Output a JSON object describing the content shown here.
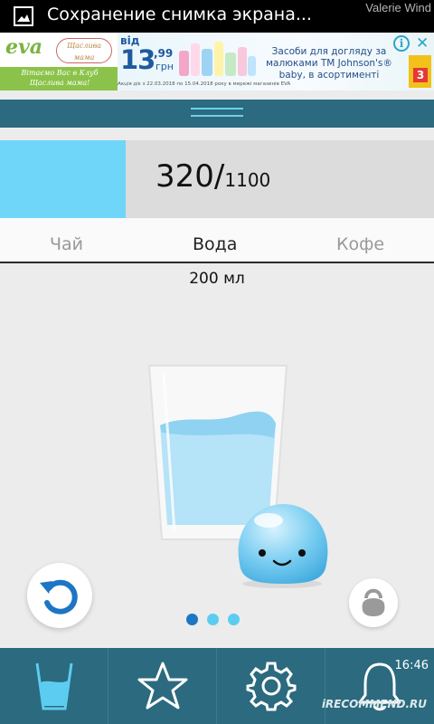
{
  "status_bar": {
    "notification_title": "Сохранение снимка экрана...",
    "watermark": "Valerie Wind"
  },
  "ad": {
    "brand": "eva",
    "partner_logo": "Щаслива мама",
    "welcome": "Вітаємо Вас в Клуб Щаслива мама!",
    "price_prefix": "від",
    "price_main": "13",
    "price_cents": ",99",
    "currency": "грн",
    "text": "Засоби для догляду за малюками ТМ Johnson's® baby, в асортименті",
    "fine_print": "Акція діє з 22.03.2018 по 15.04.2018 року в мережі магазинів EVA",
    "info_icon": "i",
    "close_icon": "✕",
    "badge": "3"
  },
  "progress": {
    "current": "320",
    "separator": "/",
    "goal": "1100",
    "fraction": 0.29
  },
  "tabs": [
    {
      "label": "Чай",
      "active": false
    },
    {
      "label": "Вода",
      "active": true
    },
    {
      "label": "Кофе",
      "active": false
    }
  ],
  "amount": "200 мл",
  "pager": {
    "count": 3,
    "active_index": 0
  },
  "icons": {
    "undo": "undo-icon",
    "weight": "kettlebell-icon",
    "glass": "glass-icon",
    "star": "star-icon",
    "settings": "gear-icon",
    "bell": "bell-icon"
  },
  "system": {
    "clock": "16:46",
    "recommend": "iRECOMMEND.RU"
  },
  "colors": {
    "header": "#2b6a7f",
    "water": "#6fd6fa",
    "accent": "#1d75c4"
  }
}
